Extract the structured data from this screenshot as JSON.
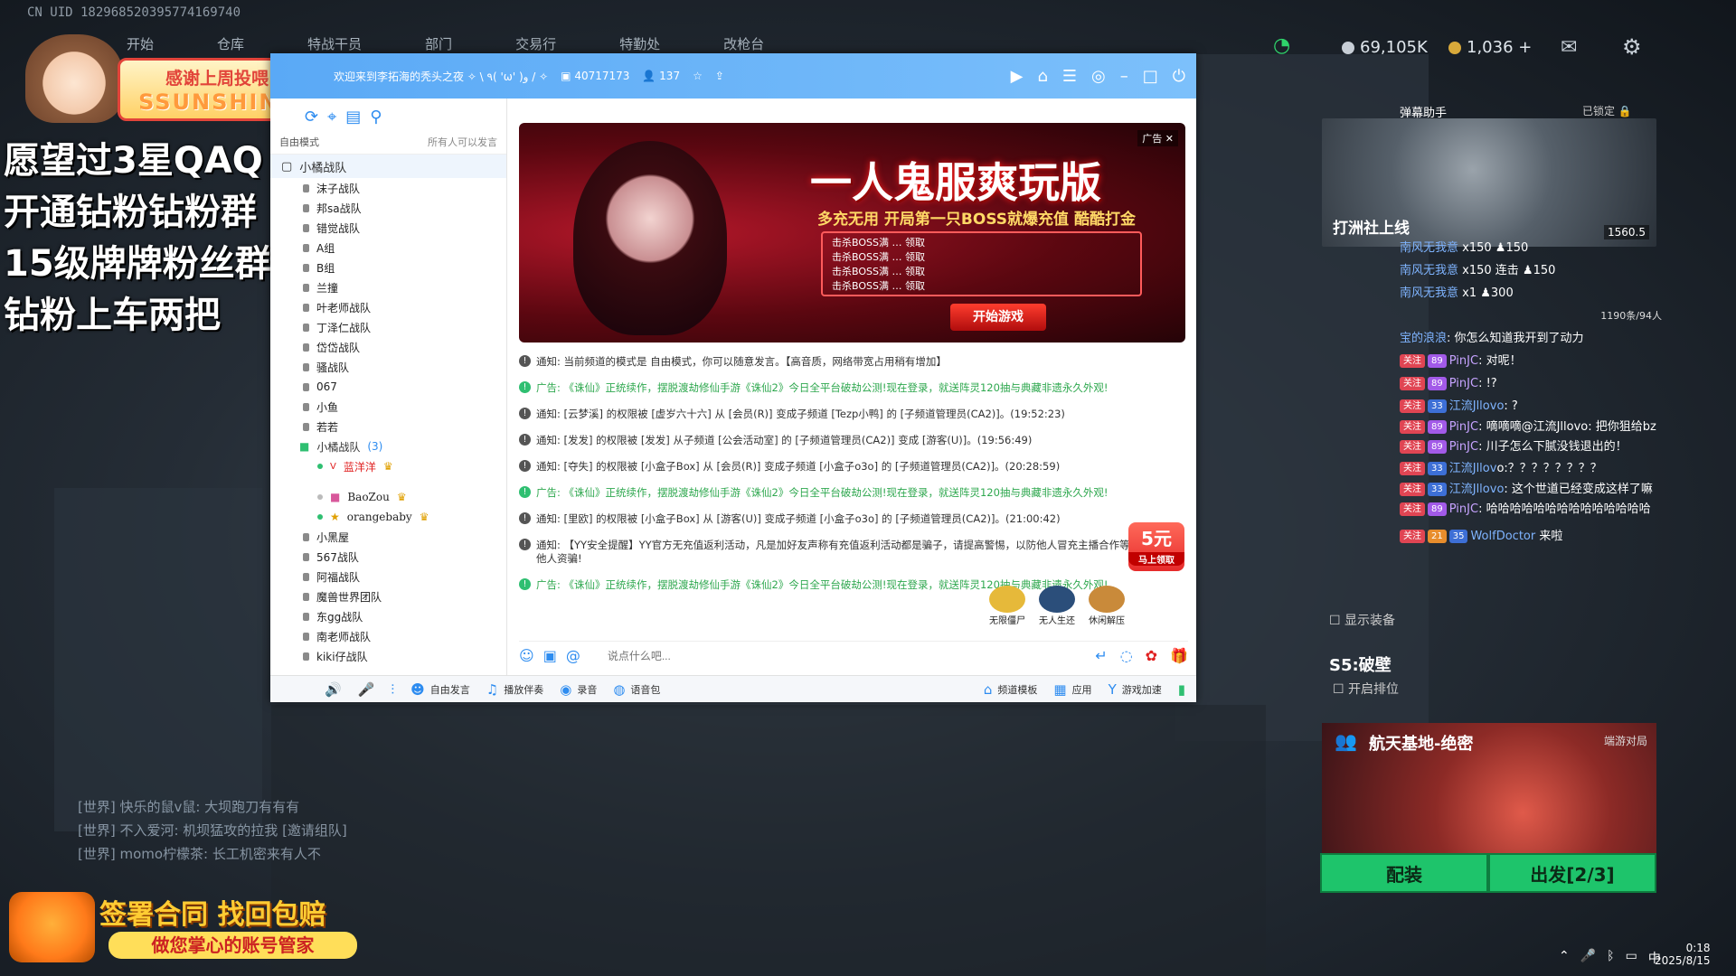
{
  "uid": "CN UID 182968520395774169740",
  "game_nav": [
    "开始",
    "仓库",
    "特战干员",
    "部门",
    "交易行",
    "特勤处",
    "改枪台"
  ],
  "game_resources": {
    "silver": "69,105K",
    "gold": "1,036 +"
  },
  "streamer_text": {
    "thanks_line1": "感谢上周投喂",
    "thanks_line2": "SSUNSHINE",
    "promo": [
      "愿望过3星QAQ",
      "开通钻粉钻粉群",
      "15级牌牌粉丝群",
      "钻粉上车两把"
    ]
  },
  "yy": {
    "title": "欢迎来到李拓海的秃头之夜 ✧ \\ ٩( 'ω' )و / ✧",
    "channel_id": "40717173",
    "online": "137",
    "mode": "自由模式",
    "mode_hint": "所有人可以发言",
    "root_channel": "小橘战队",
    "channels": [
      "沫子战队",
      "邦sa战队",
      "错觉战队",
      "A组",
      "B组",
      "兰撞",
      "叶老师战队",
      "丁泽仁战队",
      "岱岱战队",
      "骚战队",
      "067",
      "小鱼",
      "若若"
    ],
    "open_group": "小橘战队",
    "open_group_count": "(3)",
    "users": [
      "蓝洋洋",
      "BaoZou",
      "orangebaby"
    ],
    "channels_after": [
      "小黑屋",
      "567战队",
      "阿福战队",
      "魔兽世界团队",
      "东gg战队",
      "南老师战队",
      "kiki仔战队"
    ],
    "banner": {
      "ad_tag": "广告",
      "headline": "一人鬼服爽玩版",
      "sub": "多充无用 开局第一只BOSS就爆充值 酷酷打金",
      "rows": [
        "击杀BOSS满 … 领取",
        "击杀BOSS满 … 领取",
        "击杀BOSS满 … 领取",
        "击杀BOSS满 … 领取"
      ],
      "start": "开始游戏"
    },
    "messages": [
      {
        "type": "notice",
        "text": "通知: 当前频道的模式是 自由模式，你可以随意发言。【高音质，网络带宽占用稍有增加】"
      },
      {
        "type": "ad",
        "text": "广告: 《诛仙》正统续作，摆脱渡劫修仙手游《诛仙2》今日全平台破劫公测!现在登录，就送阵灵120抽与典藏非遗永久外观!"
      },
      {
        "type": "notice",
        "text": "通知: [云梦溪] 的权限被 [虚岁六十六] 从 [会员(R)] 变成子频道 [Tezp小鸭] 的 [子频道管理员(CA2)]。(19:52:23)"
      },
      {
        "type": "notice",
        "text": "通知: [发发] 的权限被 [发发] 从子频道 [公会活动室] 的 [子频道管理员(CA2)] 变成 [游客(U)]。(19:56:49)"
      },
      {
        "type": "notice",
        "text": "通知: [夺失] 的权限被 [小盒子Box] 从 [会员(R)] 变成子频道 [小盒子o3o] 的 [子频道管理员(CA2)]。(20:28:59)"
      },
      {
        "type": "ad",
        "text": "广告: 《诛仙》正统续作，摆脱渡劫修仙手游《诛仙2》今日全平台破劫公测!现在登录，就送阵灵120抽与典藏非遗永久外观!"
      },
      {
        "type": "notice",
        "text": "通知: [里欧] 的权限被 [小盒子Box] 从 [游客(U)] 变成子频道 [小盒子o3o] 的 [子频道管理员(CA2)]。(21:00:42)"
      },
      {
        "type": "notice",
        "text": "通知: 【YY安全提醒】YY官方无充值返利活动，凡是加好友声称有充值返利活动都是骗子，请提高警惕，以防他人冒充主播合作等信息诈骗他人资骗!"
      },
      {
        "type": "ad",
        "text": "广告: 《诛仙》正统续作，摆脱渡劫修仙手游《诛仙2》今日全平台破劫公测!现在登录，就送阵灵120抽与典藏非遗永久外观!"
      }
    ],
    "input_placeholder": "说点什么吧...",
    "bottom": {
      "free_speak": "自由发言",
      "accompany": "播放伴奏",
      "record": "录音",
      "voice_pack": "语音包",
      "template": "频道模板",
      "apps": "应用",
      "accelerate": "游戏加速"
    },
    "redpack": {
      "amount": "5元",
      "label": "马上领取"
    },
    "mini_games": [
      "无限僵尸",
      "无人生还",
      "休闲解压"
    ]
  },
  "assistant": {
    "title": "弹幕助手",
    "locked": "已锁定",
    "cam_label": "打洲社上线",
    "fans": "1560.5"
  },
  "chat": [
    {
      "name": "南风无我意",
      "text": "x150 ♟150"
    },
    {
      "name": "南风无我意",
      "text": "x150 连击 ♟150"
    },
    {
      "name": "南风无我意",
      "text": "x1 ♟300"
    },
    {
      "name": "宝的浪浪",
      "text": "你怎么知道我开到了动力"
    },
    {
      "name": "PinJC",
      "text": "对呢！"
    },
    {
      "name": "PinJC",
      "text": "!?"
    },
    {
      "name": "江流Jllovo",
      "text": "?"
    },
    {
      "name": "PinJC",
      "text": "嘀嘀嘀@江流Jllovo: 把你狙给bz"
    },
    {
      "name": "PinJC",
      "text": "川子怎么下腻没钱退出的！"
    },
    {
      "name": "江流Jllov",
      "text": "o:？？？？？？？？"
    },
    {
      "name": "江流Jllovo",
      "text": "这个世道已经变成这样了嘛"
    },
    {
      "name": "PinJC",
      "text": "哈哈哈哈哈哈哈哈哈哈哈哈哈哈"
    },
    {
      "name": "WolfDoctor",
      "text": "来啦"
    }
  ],
  "chat_meta": {
    "viewers": "1190条/94人",
    "show_equip": "显示装备",
    "season": "S5:破壁",
    "enable_rank": "开启排位"
  },
  "map": {
    "name": "航天基地-绝密",
    "tag": "端游对局",
    "equip": "配装",
    "depart": "出发[2/3]"
  },
  "world_chat": [
    "[世界] 快乐的鼠v鼠: 大坝跑刀有有有",
    "[世界] 不入爱河: 机坝猛攻的拉我 [邀请组队]",
    "[世界] momo柠檬茶: 长工机密来有人不"
  ],
  "bottom_ad": {
    "head": "签署合同 找回包赔",
    "sub": "做您掌心的账号管家"
  },
  "clock": {
    "time": "0:18",
    "date": "2025/8/15"
  },
  "colors": {
    "yy_blue": "#2d8cf0",
    "ad_green": "#2fa84f",
    "depart_green": "#1ec46b"
  }
}
